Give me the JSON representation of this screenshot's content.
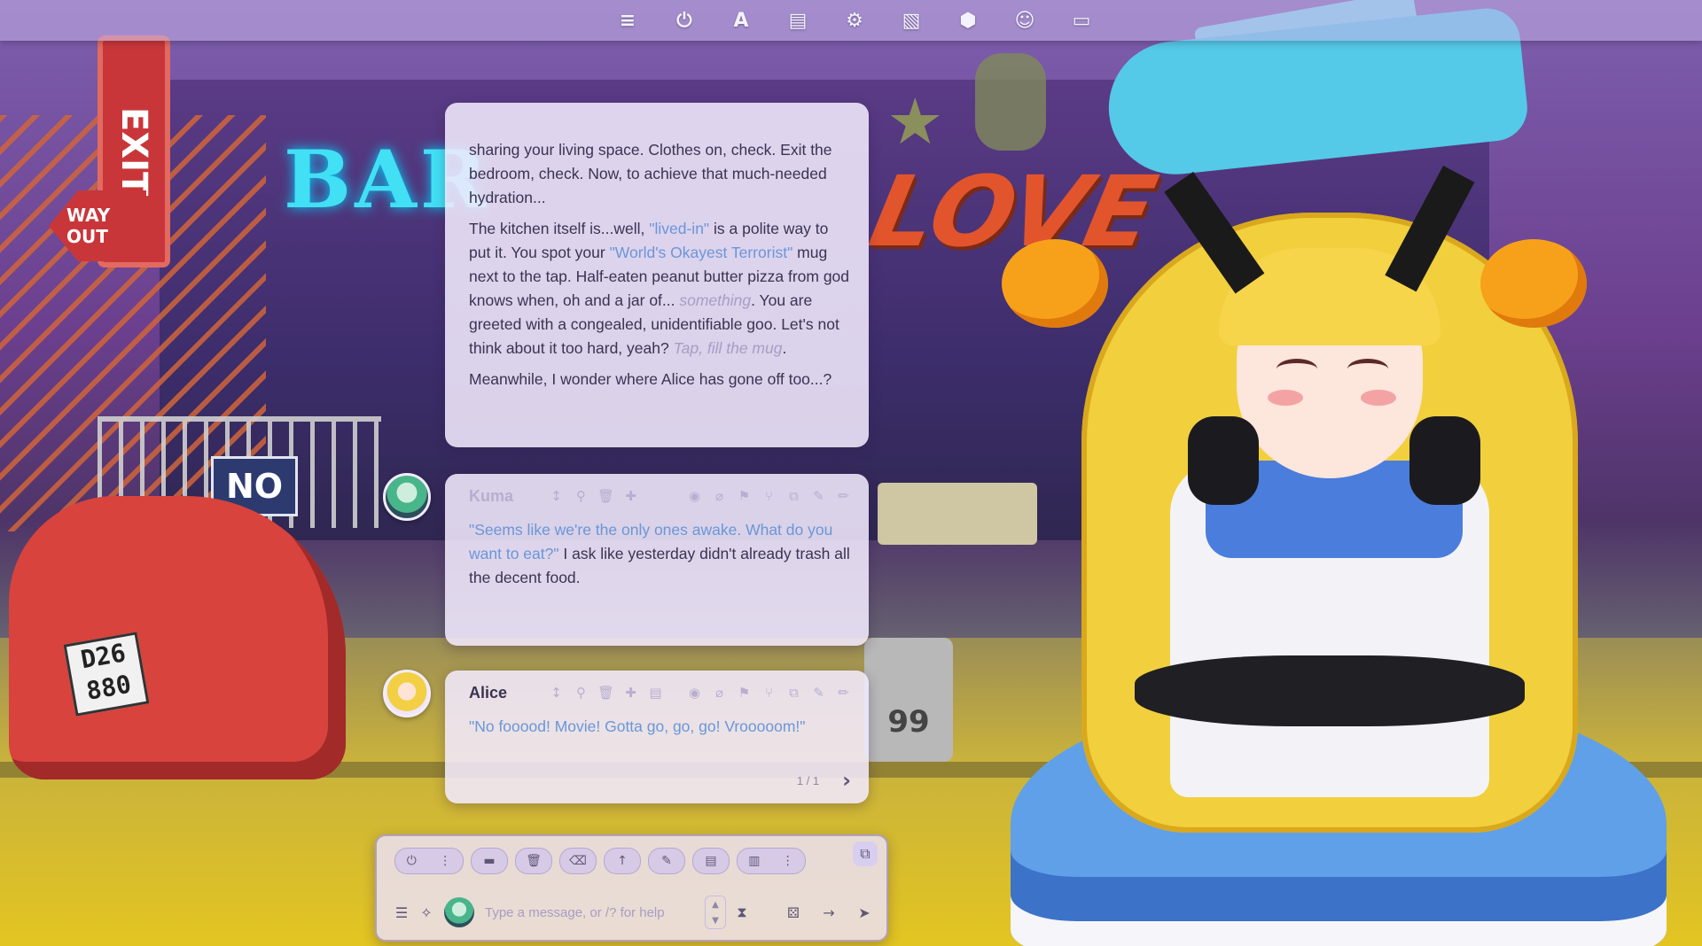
{
  "toolbar": {
    "icons": [
      {
        "name": "sliders-icon",
        "glyph": "≡"
      },
      {
        "name": "plug-icon",
        "glyph": "⏻"
      },
      {
        "name": "font-icon",
        "glyph": "A"
      },
      {
        "name": "book-icon",
        "glyph": "▤"
      },
      {
        "name": "user-gear-icon",
        "glyph": "⚙"
      },
      {
        "name": "image-icon",
        "glyph": "▧"
      },
      {
        "name": "cubes-icon",
        "glyph": "⬢"
      },
      {
        "name": "face-icon",
        "glyph": "☺"
      },
      {
        "name": "id-card-icon",
        "glyph": "▭"
      }
    ]
  },
  "scene": {
    "exit_sign": "EXIT",
    "way_out": "WAY OUT",
    "bar_sign": "BAR",
    "love_sign": "LOVE",
    "no_sign": "NO",
    "plate": "D26 880",
    "barrel": "99"
  },
  "chat": {
    "narration": {
      "p1": "sharing your living space. Clothes on, check. Exit the bedroom, check. Now, to achieve that much-needed hydration...",
      "p2_a": "The kitchen itself is...well, ",
      "p2_q1": "\"lived-in\"",
      "p2_b": " is a polite way to put it. You spot your ",
      "p2_q2": "\"World's Okayest Terrorist\"",
      "p2_c": " mug next to the tap. Half-eaten peanut butter pizza from god knows when, oh and a jar of... ",
      "p2_t1": "something",
      "p2_d": ". You are greeted with a congealed, unidentifiable goo. Let's not think about it too hard, yeah? ",
      "p2_t2": "Tap, fill the mug",
      "p2_e": ".",
      "p3": "Meanwhile, I wonder where Alice has gone off too...?"
    },
    "kuma": {
      "name": "Kuma",
      "quote": "\"Seems like we're the only ones awake. What do you want to eat?\"",
      "text": " I ask like yesterday didn't already trash all the decent food."
    },
    "alice": {
      "name": "Alice",
      "quote": "\"No fooood! Movie! Gotta go, go, go! Vrooooom!\"",
      "swipe_counter": "1 / 1",
      "swipe_next": "›"
    }
  },
  "composer": {
    "placeholder": "Type a message, or /? for help",
    "quick_buttons": [
      "⏻",
      "⋮",
      "▬",
      "🗑",
      "⌫",
      "↑",
      "✎",
      "▤",
      "▥",
      "⋮"
    ]
  },
  "colors": {
    "accent_quote": "#6a96d8",
    "thought": "#a89cc6",
    "text": "#3a3352",
    "bubble": "#f1e9fd"
  }
}
